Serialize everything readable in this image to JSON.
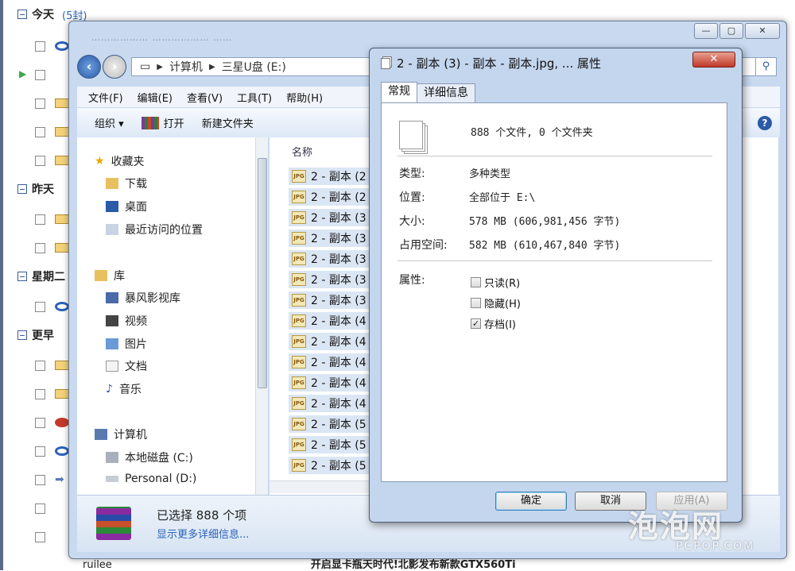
{
  "mail": {
    "groups": [
      {
        "label": "今天",
        "count": "(5封)"
      },
      {
        "label": "昨天",
        "count": ""
      },
      {
        "label": "星期二",
        "count": ""
      },
      {
        "label": "更早",
        "count": ""
      }
    ],
    "bottom_sender": "ruilee",
    "bottom_subject": "开启显卡瓶天时代!北影发布新款GTX560Ti"
  },
  "explorer": {
    "title_blurred": "……………… ……………… ……",
    "buttons": {
      "min": "—",
      "max": "▢",
      "close": "✕"
    },
    "address": {
      "computer": "计算机",
      "drive": "三星U盘 (E:)"
    },
    "menu": [
      "文件(F)",
      "编辑(E)",
      "查看(V)",
      "工具(T)",
      "帮助(H)"
    ],
    "toolbar": {
      "organize": "组织 ▾",
      "burn": "打开",
      "new_folder": "新建文件夹"
    },
    "nav": {
      "favorites": "收藏夹",
      "downloads": "下载",
      "desktop": "桌面",
      "recent": "最近访问的位置",
      "libraries": "库",
      "baofeng": "暴风影视库",
      "videos": "视频",
      "pictures": "图片",
      "documents": "文档",
      "music": "音乐",
      "computer": "计算机",
      "local_disk": "本地磁盘 (C:)",
      "personal": "Personal (D:)"
    },
    "column_name": "名称",
    "files": [
      "2 - 副本 (2",
      "2 - 副本 (2",
      "2 - 副本 (3",
      "2 - 副本 (3",
      "2 - 副本 (3",
      "2 - 副本 (3",
      "2 - 副本 (3",
      "2 - 副本 (4",
      "2 - 副本 (4",
      "2 - 副本 (4",
      "2 - 副本 (4",
      "2 - 副本 (4",
      "2 - 副本 (5",
      "2 - 副本 (5",
      "2 - 副本 (5"
    ],
    "status": {
      "selected": "已选择 888 个项",
      "more": "显示更多详细信息..."
    }
  },
  "dialog": {
    "title": "2 - 副本 (3) - 副本 - 副本.jpg, ... 属性",
    "close": "✕",
    "tabs": [
      "常规",
      "详细信息"
    ],
    "summary": "888 个文件, 0 个文件夹",
    "type_label": "类型:",
    "type_value": "多种类型",
    "location_label": "位置:",
    "location_value": "全部位于 E:\\",
    "size_label": "大小:",
    "size_value": "578 MB (606,981,456 字节)",
    "disk_label": "占用空间:",
    "disk_value": "582 MB (610,467,840 字节)",
    "attr_label": "属性:",
    "attrs": [
      {
        "label": "只读(R)",
        "checked": false
      },
      {
        "label": "隐藏(H)",
        "checked": false
      },
      {
        "label": "存档(I)",
        "checked": true
      }
    ],
    "ok": "确定",
    "cancel": "取消",
    "apply": "应用(A)"
  },
  "watermark": {
    "main": "泡泡网",
    "sub": "PCPOP.COM"
  }
}
